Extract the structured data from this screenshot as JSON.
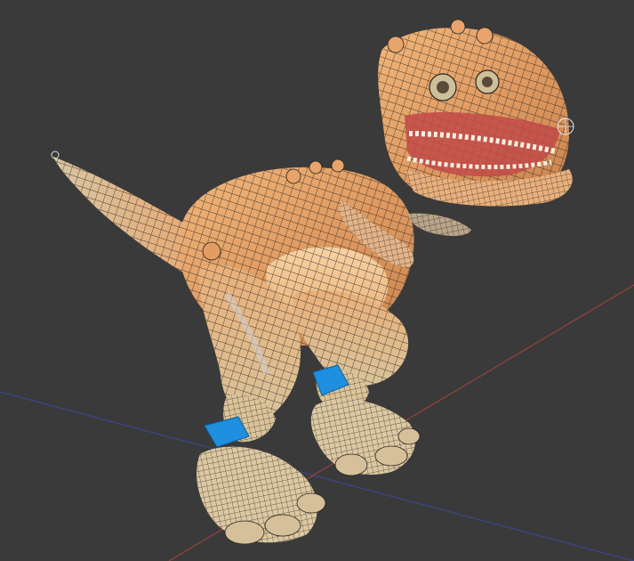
{
  "viewport": {
    "background": "#3a3a3a",
    "model": "t-rex-cartoon-wireframe-shaded",
    "shading_mode": "shaded-with-wireframe",
    "colors": {
      "body": "#e3a36c",
      "body_highlight": "#f6cf9f",
      "belly": "#f2c188",
      "wire": "#2b2620",
      "selection": "#1f8fe0",
      "grid_axis_x": "#b0443a",
      "grid_axis_z": "#3c4aa0"
    }
  }
}
